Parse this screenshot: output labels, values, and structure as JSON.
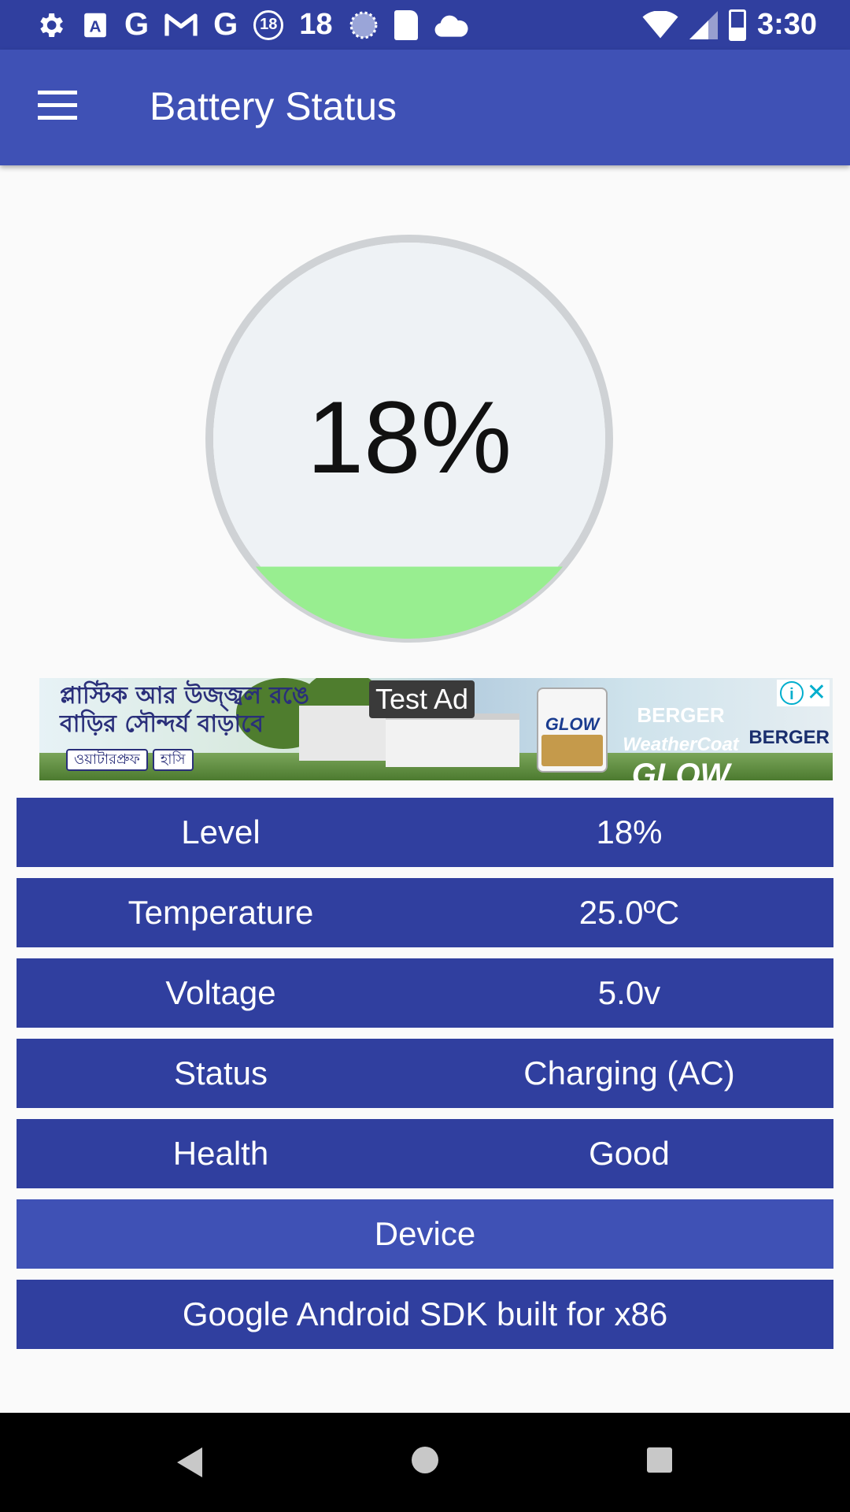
{
  "status_bar": {
    "notification_number": "18",
    "badge_number": "18",
    "time": "3:30"
  },
  "app_bar": {
    "title": "Battery Status"
  },
  "gauge": {
    "level_text": "18%",
    "level_fraction": 0.18,
    "fill_color": "#98ee90",
    "ring_color": "#cfd2d5",
    "inner_color": "#eef2f5"
  },
  "ad": {
    "label": "Test Ad",
    "headline_line1": "প্লাস্টিক আর উজ্জ্বল রঙে",
    "headline_line2": "বাড়ির সৌন্দর্য বাড়াবে",
    "pill1": "ওয়াটারপ্রুফ",
    "pill2": "হাসি",
    "can_label": "GLOW",
    "brand_line1": "BERGER",
    "brand_line2": "WeatherCoat",
    "brand_line3": "GLOW",
    "corner_brand": "BERGER"
  },
  "info_rows": [
    {
      "key": "Level",
      "value": "18%"
    },
    {
      "key": "Temperature",
      "value": "25.0ºC"
    },
    {
      "key": "Voltage",
      "value": "5.0v"
    },
    {
      "key": "Status",
      "value": "Charging (AC)"
    },
    {
      "key": "Health",
      "value": "Good"
    }
  ],
  "device": {
    "header": "Device",
    "name": "Google Android SDK built for x86"
  },
  "colors": {
    "primary": "#3f51b5",
    "primary_dark": "#303f9f"
  }
}
